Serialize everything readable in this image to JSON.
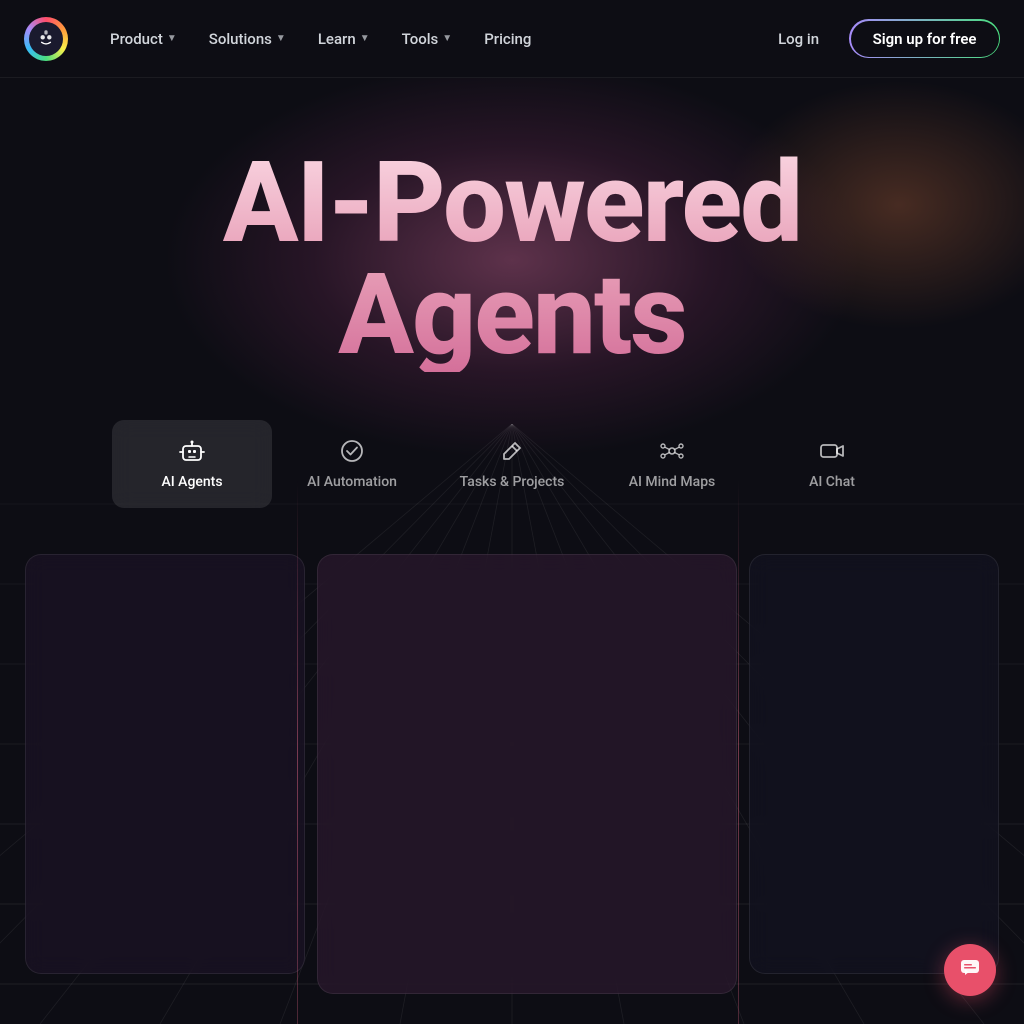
{
  "brand": {
    "logo_emoji": "🥷",
    "logo_alt": "Brand logo"
  },
  "nav": {
    "items": [
      {
        "label": "Product",
        "has_dropdown": true
      },
      {
        "label": "Solutions",
        "has_dropdown": true
      },
      {
        "label": "Learn",
        "has_dropdown": true
      },
      {
        "label": "Tools",
        "has_dropdown": true
      },
      {
        "label": "Pricing",
        "has_dropdown": false
      }
    ],
    "login_label": "Log in",
    "signup_label": "Sign up for free"
  },
  "hero": {
    "title_line1": "AI-Powered",
    "title_line2": "Agents"
  },
  "feature_tabs": [
    {
      "id": "ai-agents",
      "label": "AI Agents",
      "icon": "🤖",
      "active": true
    },
    {
      "id": "ai-automation",
      "label": "AI Automation",
      "icon": "✅",
      "active": false
    },
    {
      "id": "tasks-projects",
      "label": "Tasks & Projects",
      "icon": "✏️",
      "active": false
    },
    {
      "id": "ai-mind-maps",
      "label": "AI Mind Maps",
      "icon": "⬡",
      "active": false
    },
    {
      "id": "ai-chat",
      "label": "AI Chat",
      "icon": "📹",
      "active": false
    }
  ],
  "chat_button": {
    "icon": "💬",
    "label": "Open chat"
  }
}
